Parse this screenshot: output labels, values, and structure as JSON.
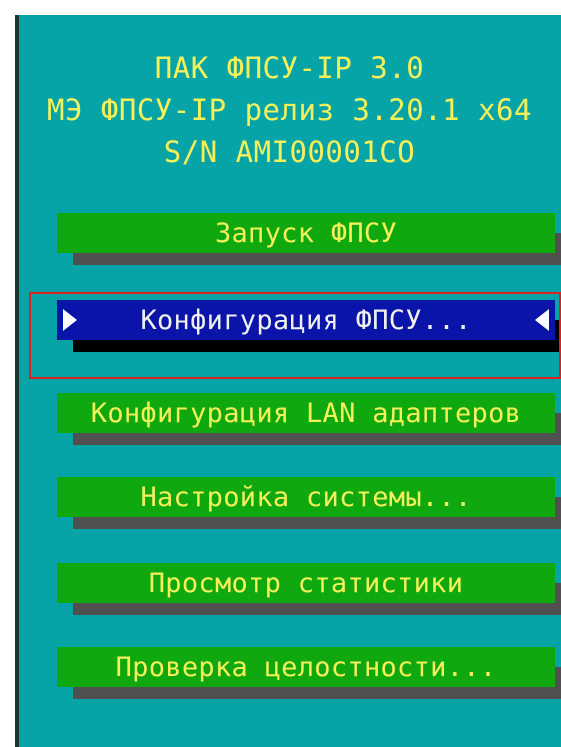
{
  "header": {
    "line1": "ПАК ФПСУ-IP 3.0",
    "line2": "МЭ ФПСУ-IP релиз 3.20.1 x64",
    "line3": "S/N AMI00001CO"
  },
  "menu": {
    "items": [
      {
        "label": "Запуск ФПСУ",
        "selected": false
      },
      {
        "label": "Конфигурация ФПСУ...",
        "selected": true
      },
      {
        "label": "Конфигурация LAN адаптеров",
        "selected": false
      },
      {
        "label": "Настройка системы...",
        "selected": false
      },
      {
        "label": "Просмотр статистики",
        "selected": false
      },
      {
        "label": "Проверка целостности...",
        "selected": false
      }
    ]
  },
  "colors": {
    "background": "#06a4a6",
    "button_face": "#0fa80f",
    "button_text": "#f5f05a",
    "selected_face": "#0a14a8",
    "selected_text": "#f0f0f0",
    "shadow": "#505050",
    "highlight_frame": "#e02020"
  }
}
